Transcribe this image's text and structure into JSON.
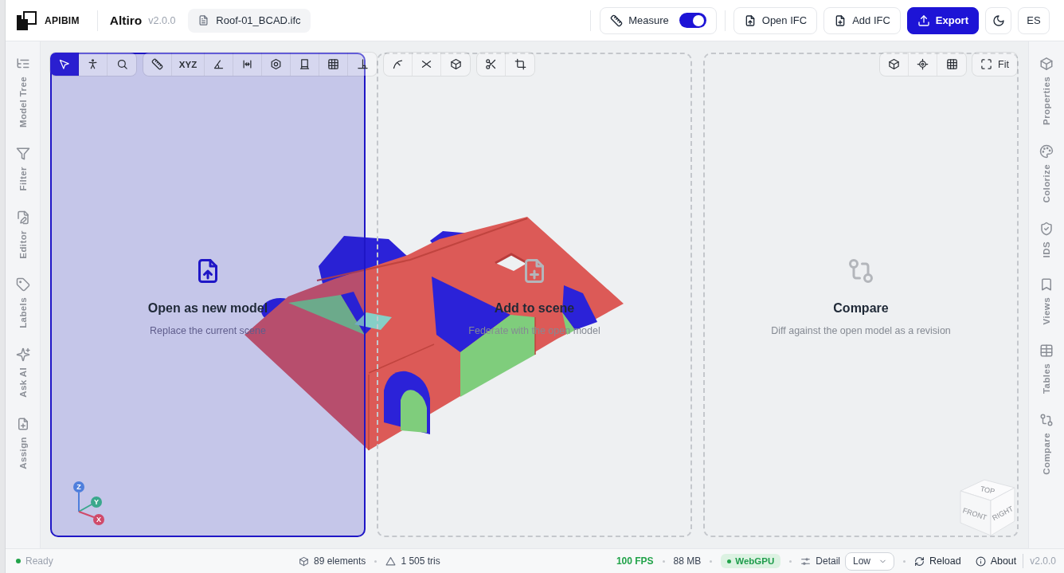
{
  "header": {
    "brand": "APIBIM",
    "app_name": "Altiro",
    "app_version": "v2.0.0",
    "file_name": "Roof-01_BCAD.ifc",
    "measure": {
      "label": "Measure",
      "on": true
    },
    "actions": [
      {
        "label": "Open IFC",
        "primary": false
      },
      {
        "label": "Add IFC",
        "primary": false
      },
      {
        "label": "Export",
        "primary": true
      }
    ],
    "language": "ES"
  },
  "left_rail": [
    "Model Tree",
    "Filter",
    "Editor",
    "Labels",
    "Ask AI",
    "Assign"
  ],
  "right_rail": [
    "Properties",
    "Colorize",
    "IDS",
    "Views",
    "Tables",
    "Compare"
  ],
  "viewport_toolbar": [
    {
      "tools": [
        {
          "selected": true
        },
        {
          "selected": false
        },
        {
          "selected": false
        }
      ]
    },
    {
      "tools": [
        {
          "selected": false
        },
        {
          "label": "XYZ",
          "selected": false
        },
        {
          "selected": false
        },
        {
          "selected": false
        },
        {
          "selected": false
        },
        {
          "selected": false
        },
        {
          "selected": false
        },
        {
          "selected": false
        }
      ]
    },
    {
      "tools": [
        {
          "selected": false
        },
        {
          "selected": false
        },
        {
          "selected": false
        }
      ]
    },
    {
      "tools": [
        {
          "selected": false
        },
        {
          "selected": false
        }
      ]
    }
  ],
  "view_toolbar": {
    "fit_label": "Fit"
  },
  "drop_zones": [
    {
      "title": "Open as new model",
      "subtitle": "Replace the current scene",
      "selected": true
    },
    {
      "title": "Add to scene",
      "subtitle": "Federate with the open model",
      "selected": false
    },
    {
      "title": "Compare",
      "subtitle": "Diff against the open model as a revision",
      "selected": false
    }
  ],
  "axis_gizmo": [
    "Z",
    "Y",
    "X"
  ],
  "view_cube": [
    "TOP",
    "FRONT",
    "RIGHT"
  ],
  "status_bar": {
    "state": {
      "label": "Ready",
      "ok": true
    },
    "elements": "89 elements",
    "triangles": "1 505 tris",
    "fps": "100 FPS",
    "memory": "88 MB",
    "renderer": {
      "label": "WebGPU",
      "active": true
    },
    "detail": {
      "label": "Detail",
      "value": "Low"
    },
    "reload": "Reload",
    "about": "About",
    "version": "v2.0.0"
  }
}
